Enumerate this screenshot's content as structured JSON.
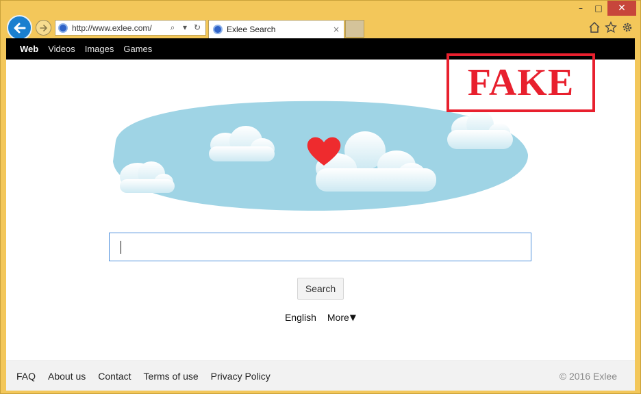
{
  "browser": {
    "address_url": "http://www.exlee.com/",
    "tab_title": "Exlee Search",
    "tab_close": "×",
    "window_controls": {
      "minimize": "–",
      "maximize": "□",
      "close": "✕"
    },
    "address_icons": {
      "search": "⌕",
      "dropdown": "▾",
      "refresh": "↻"
    },
    "toolbar_icons": [
      "home-icon",
      "star-icon",
      "gear-icon"
    ]
  },
  "topnav": {
    "items": [
      {
        "label": "Web",
        "active": true
      },
      {
        "label": "Videos"
      },
      {
        "label": "Images"
      },
      {
        "label": "Games"
      }
    ]
  },
  "stamp": {
    "text": "FAKE",
    "color": "#e8202e"
  },
  "search": {
    "button_label": "Search"
  },
  "language": {
    "current": "English",
    "more_label": "More",
    "more_arrow": "▼"
  },
  "footer": {
    "links": [
      "FAQ",
      "About us",
      "Contact",
      "Terms of use",
      "Privacy Policy"
    ],
    "copyright": "© 2016 Exlee"
  },
  "colors": {
    "frame": "#f3c75a",
    "sky": "#9fd4e5",
    "heart": "#ee2b2e",
    "accent_blue": "#4d8fdc"
  }
}
